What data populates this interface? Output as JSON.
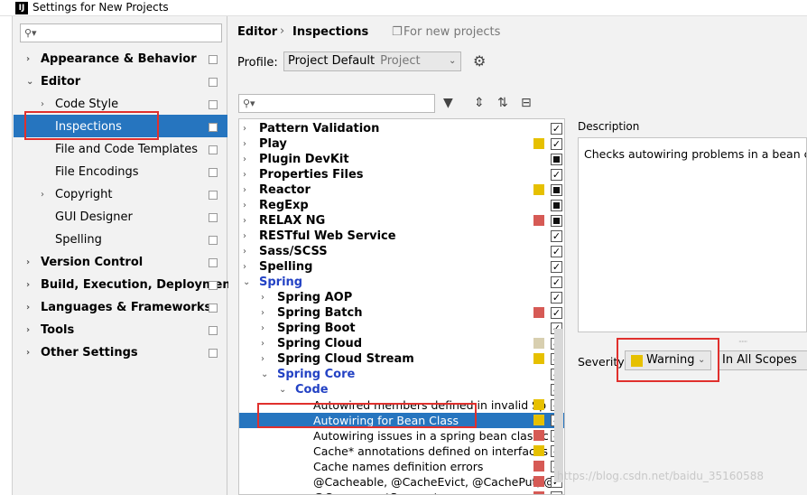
{
  "window": {
    "title": "Settings for New Projects",
    "app_icon": "IJ"
  },
  "left_nav": {
    "search_placeholder": "",
    "items": [
      {
        "label": "Appearance & Behavior",
        "level": 0,
        "bold": true,
        "arrow": "›"
      },
      {
        "label": "Editor",
        "level": 0,
        "bold": true,
        "arrow": "⌄"
      },
      {
        "label": "Code Style",
        "level": 1,
        "bold": false,
        "arrow": "›"
      },
      {
        "label": "Inspections",
        "level": 1,
        "bold": false,
        "arrow": "",
        "selected": true
      },
      {
        "label": "File and Code Templates",
        "level": 1,
        "bold": false,
        "arrow": ""
      },
      {
        "label": "File Encodings",
        "level": 1,
        "bold": false,
        "arrow": ""
      },
      {
        "label": "Copyright",
        "level": 1,
        "bold": false,
        "arrow": "›"
      },
      {
        "label": "GUI Designer",
        "level": 1,
        "bold": false,
        "arrow": ""
      },
      {
        "label": "Spelling",
        "level": 1,
        "bold": false,
        "arrow": ""
      },
      {
        "label": "Version Control",
        "level": 0,
        "bold": true,
        "arrow": "›"
      },
      {
        "label": "Build, Execution, Deployment",
        "level": 0,
        "bold": true,
        "arrow": "›"
      },
      {
        "label": "Languages & Frameworks",
        "level": 0,
        "bold": true,
        "arrow": "›"
      },
      {
        "label": "Tools",
        "level": 0,
        "bold": true,
        "arrow": "›"
      },
      {
        "label": "Other Settings",
        "level": 0,
        "bold": true,
        "arrow": "›"
      }
    ]
  },
  "header": {
    "crumb_editor": "Editor",
    "crumb_sep": "›",
    "crumb_inspections": "Inspections",
    "note": "For new projects"
  },
  "profile": {
    "label": "Profile:",
    "value": "Project Default",
    "sub": "Project"
  },
  "inspections": [
    {
      "label": "Pattern Validation",
      "indent": 0,
      "arrow": "›",
      "style": "bold",
      "sev": "",
      "check": "checked"
    },
    {
      "label": "Play",
      "indent": 0,
      "arrow": "›",
      "style": "bold",
      "sev": "#e6c000",
      "check": "checked"
    },
    {
      "label": "Plugin DevKit",
      "indent": 0,
      "arrow": "›",
      "style": "bold",
      "sev": "",
      "check": "indet"
    },
    {
      "label": "Properties Files",
      "indent": 0,
      "arrow": "›",
      "style": "bold",
      "sev": "",
      "check": "checked"
    },
    {
      "label": "Reactor",
      "indent": 0,
      "arrow": "›",
      "style": "bold",
      "sev": "#e6c000",
      "check": "indet"
    },
    {
      "label": "RegExp",
      "indent": 0,
      "arrow": "›",
      "style": "bold",
      "sev": "",
      "check": "indet"
    },
    {
      "label": "RELAX NG",
      "indent": 0,
      "arrow": "›",
      "style": "bold",
      "sev": "#d65a55",
      "check": "indet"
    },
    {
      "label": "RESTful Web Service",
      "indent": 0,
      "arrow": "›",
      "style": "bold",
      "sev": "",
      "check": "checked"
    },
    {
      "label": "Sass/SCSS",
      "indent": 0,
      "arrow": "›",
      "style": "bold",
      "sev": "",
      "check": "checked"
    },
    {
      "label": "Spelling",
      "indent": 0,
      "arrow": "›",
      "style": "bold",
      "sev": "",
      "check": "checked"
    },
    {
      "label": "Spring",
      "indent": 0,
      "arrow": "⌄",
      "style": "blue",
      "sev": "",
      "check": "checked"
    },
    {
      "label": "Spring AOP",
      "indent": 1,
      "arrow": "›",
      "style": "bold",
      "sev": "",
      "check": "checked"
    },
    {
      "label": "Spring Batch",
      "indent": 1,
      "arrow": "›",
      "style": "bold",
      "sev": "#d65a55",
      "check": "checked"
    },
    {
      "label": "Spring Boot",
      "indent": 1,
      "arrow": "›",
      "style": "bold",
      "sev": "",
      "check": "checked"
    },
    {
      "label": "Spring Cloud",
      "indent": 1,
      "arrow": "›",
      "style": "bold",
      "sev": "#d8cfb0",
      "check": "checked"
    },
    {
      "label": "Spring Cloud Stream",
      "indent": 1,
      "arrow": "›",
      "style": "bold",
      "sev": "#e6c000",
      "check": "checked"
    },
    {
      "label": "Spring Core",
      "indent": 1,
      "arrow": "⌄",
      "style": "blue",
      "sev": "",
      "check": "checked"
    },
    {
      "label": "Code",
      "indent": 2,
      "arrow": "⌄",
      "style": "blue",
      "sev": "",
      "check": "checked"
    },
    {
      "label": "Autowired members defined in invalid Sp",
      "indent": 3,
      "arrow": "",
      "style": "plain",
      "sev": "#e6c000",
      "check": "checked"
    },
    {
      "label": "Autowiring for Bean Class",
      "indent": 3,
      "arrow": "",
      "style": "plain",
      "sev": "#e6c000",
      "check": "checked",
      "selected": true
    },
    {
      "label": "Autowiring issues in a spring bean class c",
      "indent": 3,
      "arrow": "",
      "style": "plain",
      "sev": "#d65a55",
      "check": "checked"
    },
    {
      "label": "Cache* annotations defined on interfaces",
      "indent": 3,
      "arrow": "",
      "style": "plain",
      "sev": "#e6c000",
      "check": "checked"
    },
    {
      "label": "Cache names definition errors",
      "indent": 3,
      "arrow": "",
      "style": "plain",
      "sev": "#d65a55",
      "check": "checked"
    },
    {
      "label": "@Cacheable, @CacheEvict, @CachePut, @",
      "indent": 3,
      "arrow": "",
      "style": "plain",
      "sev": "#d65a55",
      "check": "checked"
    },
    {
      "label": "@ComponentScan setup",
      "indent": 3,
      "arrow": "",
      "style": "plain",
      "sev": "#d65a55",
      "check": "checked"
    }
  ],
  "description": {
    "label": "Description",
    "text": "Checks autowiring problems in a bean class."
  },
  "severity": {
    "label": "Severity:",
    "value": "Warning",
    "color": "#e6c000",
    "scope": "In All Scopes"
  },
  "watermark": "https://blog.csdn.net/baidu_35160588"
}
